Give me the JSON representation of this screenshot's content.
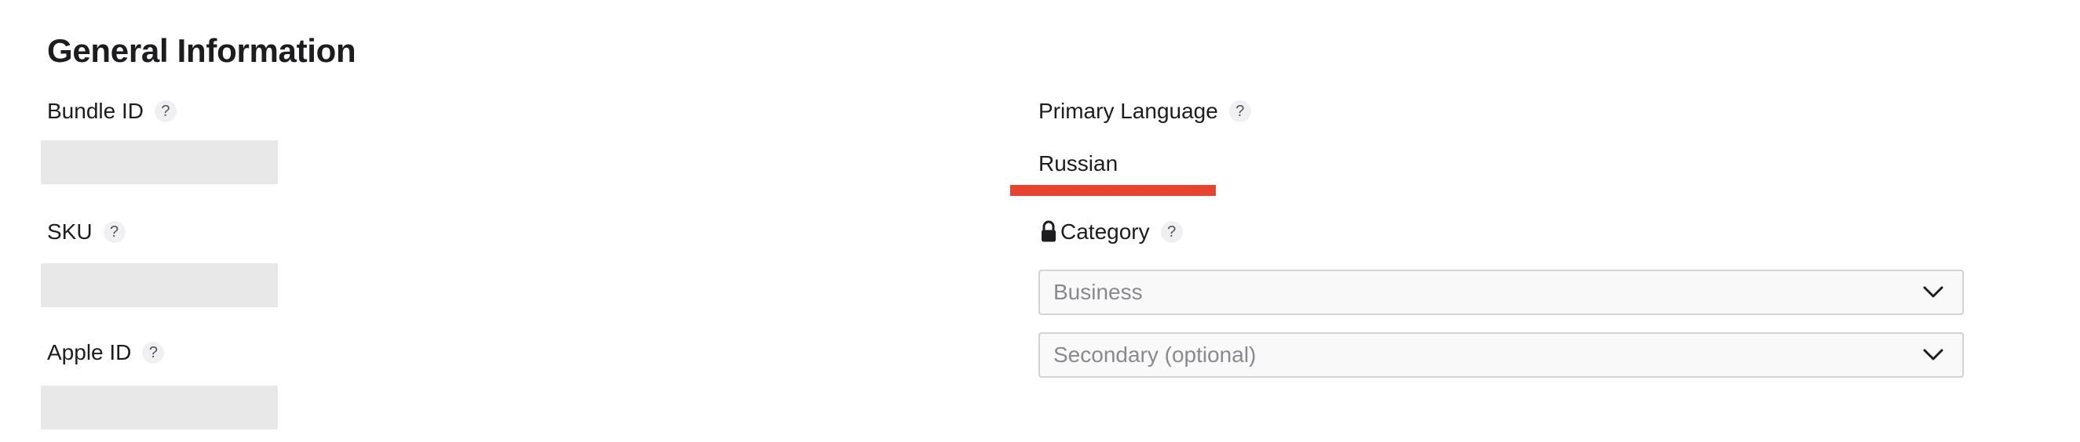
{
  "section": {
    "title": "General Information"
  },
  "left": {
    "bundle_id": {
      "label": "Bundle ID",
      "help": "?"
    },
    "sku": {
      "label": "SKU",
      "help": "?"
    },
    "apple_id": {
      "label": "Apple ID",
      "help": "?"
    }
  },
  "right": {
    "primary_language": {
      "label": "Primary Language",
      "help": "?",
      "value": "Russian"
    },
    "category": {
      "label": "Category",
      "help": "?",
      "locked_icon": "lock-icon",
      "primary_value": "Business",
      "secondary_placeholder": "Secondary (optional)"
    }
  },
  "colors": {
    "highlight_bar": "#e8432e",
    "redacted": "#e8e8e8",
    "select_border": "#d2d2d7",
    "placeholder_text": "#8a8a8e"
  }
}
